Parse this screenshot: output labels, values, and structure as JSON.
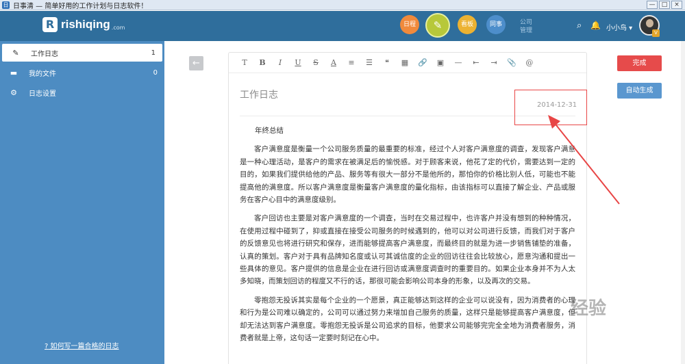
{
  "window": {
    "title": "日事清 — 简单好用的工作计划与日志软件！",
    "controls": [
      "—",
      "□",
      "×"
    ]
  },
  "topnav": {
    "logo_text": "rishiqing",
    "logo_suffix": ".com",
    "schedule": "日程",
    "write_icon": "✎",
    "board": "看板",
    "colleague": "同事",
    "company": "公司管理",
    "user_name": "小小鸟 ▾",
    "vip": "V"
  },
  "sidebar": {
    "items": [
      {
        "label": "工作日志",
        "count": "1",
        "icon": "pencil-icon"
      },
      {
        "label": "我的文件",
        "count": "0",
        "icon": "folder-icon"
      },
      {
        "label": "日志设置",
        "count": "",
        "icon": "gear-icon"
      }
    ],
    "help": "如何写一篇合格的日志"
  },
  "editor": {
    "title": "工作日志",
    "date": "2014-12-31",
    "heading": "年终总结",
    "paragraphs": [
      "客户满意度是衡量一个公司服务质量的最重要的标准，经过个人对客户满意度的调查，发现客户满意是一种心理活动，是客户的需求在被满足后的愉悦感。对于顾客来说，他花了定的代价，需要达到一定的目的，如果我们提供给他的产品、服务等有很大一部分不是他所的，那怕你的价格比别人低，可能也不能提高他的满意度。所以客户满意度是衡量客户满意度的量化指标，由该指标可以直接了解企业、产品或服务在客户心目中的满意度级别。",
      "客户回访也主要是对客户满意度的一个调查，当时在交易过程中，也许客户并没有想到的种种情况，在使用过程中碰到了，抑或直接在接受公司服务的时候遇到的，他可以对公司进行反馈，而我们对于客户的反馈意见也将进行研究和保存，进而能够提高客户满意度，而最终目的就是为进一步销售铺垫的准备，认真的策划。客户对于具有品牌知名度或认可其诚信度的企业的回访往往会比较放心，愿意沟通和提出一些具体的意见。客户提供的信息是企业在进行回访或满意度调查时的重要目的。如果企业本身并不为人太多知晓，而策划回访的程度又不行的话，那很可能会影响公司本身的形象，以及再次的交易。",
      "零抱怨无投诉其实是每个企业的一个愿景，真正能够达到这样的企业可以说没有，因为消费者的心理和行为是公司难以确定的，公司可以通过努力来增加自己服务的质量，这样只是能够提高客户满意度，但却无法达到客户满意度。零抱怨无投诉是公司追求的目标，他要求公司能够完完全全地为消费者服务，消费者就是上帝，这句话一定要时刻记在心中。"
    ]
  },
  "toolbar": [
    "T",
    "B",
    "I",
    "U",
    "S",
    "A",
    "≡",
    "☰",
    "❝",
    "▦",
    "🔗",
    "▣",
    "—",
    "⇤",
    "⇥",
    "📎",
    "@"
  ],
  "actions": {
    "done": "完成",
    "auto": "自动生成"
  },
  "watermark": "经验",
  "colors": {
    "nav": "#2f6e9c",
    "sidebar": "#4d8cc2",
    "done": "#e64b4b",
    "auto": "#5a97cf",
    "annotation": "#e84545"
  }
}
